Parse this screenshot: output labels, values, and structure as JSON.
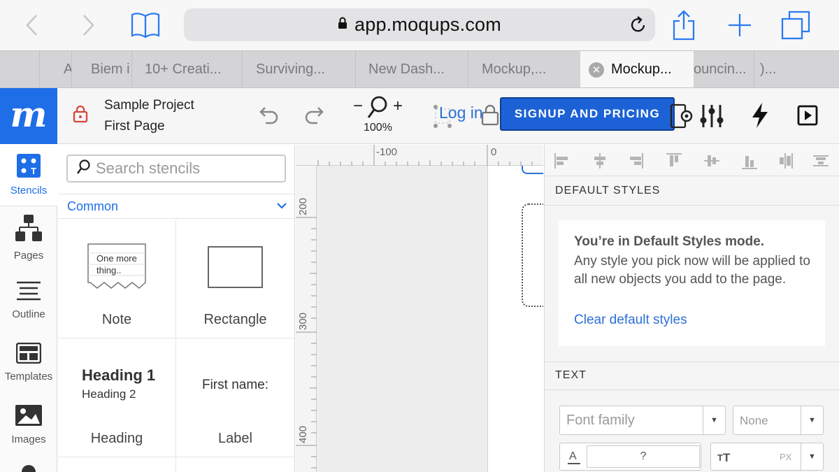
{
  "browser": {
    "url": "app.moqups.com",
    "tabs": [
      {
        "label": "A"
      },
      {
        "label": "Biem i"
      },
      {
        "label": "10+ Creati..."
      },
      {
        "label": "Surviving..."
      },
      {
        "label": "New Dash..."
      },
      {
        "label": "Mockup,..."
      },
      {
        "label": "Mockup...",
        "active": true
      },
      {
        "label": "ouncin..."
      },
      {
        "label": ")..."
      }
    ]
  },
  "header": {
    "logo": "m",
    "project_name": "Sample Project",
    "page_name": "First Page",
    "zoom_minus": "−",
    "zoom_plus": "+",
    "zoom_level": "100%",
    "login": "Log in",
    "signup": "SIGNUP AND PRICING"
  },
  "rail": {
    "items": [
      {
        "label": "Stencils",
        "icon": "stencils-icon"
      },
      {
        "label": "Pages",
        "icon": "pages-icon"
      },
      {
        "label": "Outline",
        "icon": "outline-icon"
      },
      {
        "label": "Templates",
        "icon": "templates-icon"
      },
      {
        "label": "Images",
        "icon": "images-icon"
      }
    ]
  },
  "stencils": {
    "search_placeholder": "Search stencils",
    "category": "Common",
    "items": [
      {
        "label": "Note",
        "preview_text": "One more thing.."
      },
      {
        "label": "Rectangle"
      },
      {
        "label": "Heading",
        "preview_h1": "Heading 1",
        "preview_h2": "Heading 2"
      },
      {
        "label": "Label",
        "preview_text": "First name:"
      }
    ]
  },
  "canvas": {
    "ruler_top": [
      "-100",
      "0"
    ],
    "ruler_left": [
      "200",
      "300",
      "400"
    ]
  },
  "right_panel": {
    "default_styles_title": "DEFAULT STYLES",
    "mode_heading": "You’re in Default Styles mode.",
    "mode_body": "Any style you pick now will be applied to all new objects you add to the page.",
    "clear_link": "Clear default styles",
    "text_title": "TEXT",
    "font_family_placeholder": "Font family",
    "style_value": "None",
    "color_value": "?",
    "size_unit": "PX"
  },
  "colors": {
    "brand": "#1e6ee8",
    "signup_bg": "#1c62d6",
    "link": "#2c6fd8"
  }
}
